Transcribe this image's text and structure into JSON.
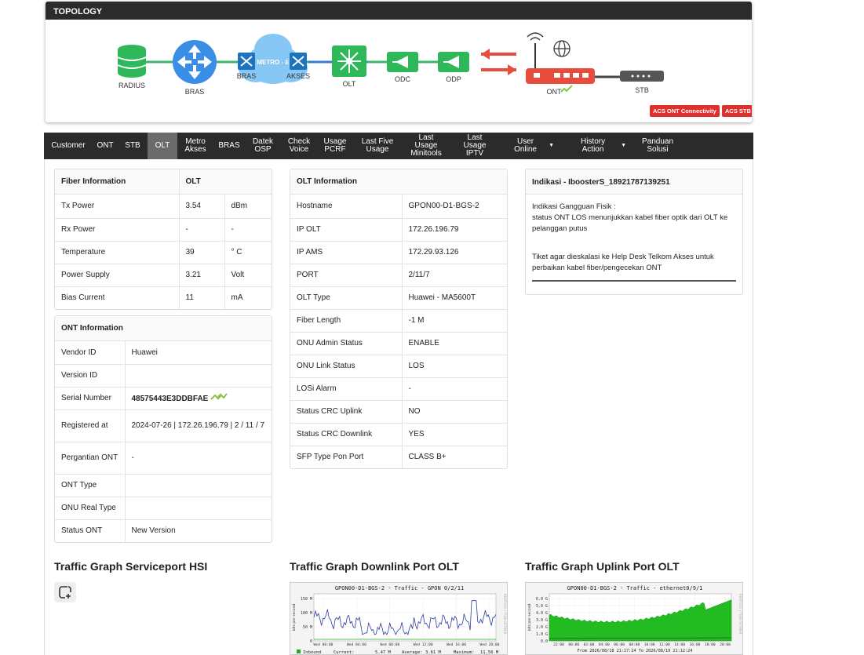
{
  "topology": {
    "title": "TOPOLOGY",
    "nodes": {
      "radius": "RADIUS",
      "bras": "BRAS",
      "bras2": "BRAS",
      "metro": "METRO - E",
      "akses": "AKSES",
      "olt": "OLT",
      "odc": "ODC",
      "odp": "ODP",
      "ont": "ONT",
      "stb": "STB"
    },
    "acs_ont": "ACS ONT Connectivity",
    "acs_stb": "ACS STB Connectivity"
  },
  "nav": [
    {
      "label": "Customer",
      "active": false
    },
    {
      "label": "ONT",
      "active": false
    },
    {
      "label": "STB",
      "active": false
    },
    {
      "label": "OLT",
      "active": true
    },
    {
      "label": "Metro\nAkses",
      "active": false
    },
    {
      "label": "BRAS",
      "active": false
    },
    {
      "label": "Datek\nOSP",
      "active": false
    },
    {
      "label": "Check\nVoice",
      "active": false
    },
    {
      "label": "Usage\nPCRF",
      "active": false
    },
    {
      "label": "Last Five\nUsage",
      "active": false
    },
    {
      "label": "Last Usage\nMinitools",
      "active": false
    },
    {
      "label": "Last Usage\nIPTV",
      "active": false
    },
    {
      "label": "User Online",
      "active": false,
      "dropdown": true
    },
    {
      "label": "History Action",
      "active": false,
      "dropdown": true
    },
    {
      "label": "Panduan\nSolusi",
      "active": false
    }
  ],
  "fiber": {
    "header": [
      "Fiber Information",
      "OLT"
    ],
    "rows": [
      [
        "Tx Power",
        "3.54",
        "dBm"
      ],
      [
        "Rx Power",
        "-",
        "-"
      ],
      [
        "Temperature",
        "39",
        "° C"
      ],
      [
        "Power Supply",
        "3.21",
        "Volt"
      ],
      [
        "Bias Current",
        "11",
        "mA"
      ]
    ]
  },
  "ont": {
    "title": "ONT Information",
    "rows": [
      [
        "Vendor ID",
        "Huawei"
      ],
      [
        "Version ID",
        ""
      ],
      [
        "Serial Number",
        "48575443E3DDBFAE"
      ],
      [
        "Registered at",
        "2024-07-26 | 172.26.196.79 | 2 / 11 / 7"
      ],
      [
        "Pergantian ONT",
        "-"
      ],
      [
        "ONT Type",
        ""
      ],
      [
        "ONU Real Type",
        ""
      ],
      [
        "Status ONT",
        "New Version"
      ]
    ]
  },
  "olt": {
    "title": "OLT Information",
    "rows": [
      [
        "Hostname",
        "GPON00-D1-BGS-2"
      ],
      [
        "IP OLT",
        "172.26.196.79"
      ],
      [
        "IP AMS",
        "172.29.93.126"
      ],
      [
        "PORT",
        "2/11/7"
      ],
      [
        "OLT Type",
        "Huawei - MA5600T"
      ],
      [
        "Fiber Length",
        "-1 M"
      ],
      [
        "ONU Admin Status",
        "ENABLE"
      ],
      [
        "ONU Link Status",
        "LOS"
      ],
      [
        "LOSi Alarm",
        "-"
      ],
      [
        "Status CRC Uplink",
        "NO"
      ],
      [
        "Status CRC Downlink",
        "YES"
      ],
      [
        "SFP Type Pon Port",
        "CLASS B+"
      ]
    ]
  },
  "indikasi": {
    "title": "Indikasi - IboosterS_18921787139251",
    "line1": "Indikasi Gangguan Fisik :",
    "line2": "status ONT LOS menunjukkan kabel fiber optik dari OLT ke pelanggan putus",
    "line3": "Tiket agar dieskalasi ke Help Desk Telkom Akses untuk perbaikan kabel fiber/pengecekan ONT"
  },
  "traffic": {
    "hsi_title": "Traffic Graph Serviceport HSI",
    "down_title": "Traffic Graph Downlink Port OLT",
    "up_title": "Traffic Graph Uplink Port OLT",
    "down_graph": {
      "title": "GPON00-D1-BGS-2 - Traffic - GPON 0/2/11",
      "yaxis": "bits per second",
      "yticks": [
        "150 M",
        "100 M",
        "50 M",
        "0"
      ],
      "xticks": [
        "Wed 00:00",
        "Wed 04:00",
        "Wed 08:00",
        "Wed 12:00",
        "Wed 16:00",
        "Wed 20:00"
      ],
      "legend": "Inbound",
      "current": "Current:",
      "current_val": "5.47 M",
      "average": "Average:",
      "average_val": "3.61 M",
      "maximum": "Maximum:",
      "maximum_val": "11.56 M",
      "side": "RRDTOOL / TOBI OETIKER",
      "color": "#2a3fa0"
    },
    "up_graph": {
      "title": "GPON00-D1-BGS-2 - Traffic - ethernet0/9/1",
      "yaxis": "bits per second",
      "yticks": [
        "6.0 G",
        "5.0 G",
        "4.0 G",
        "3.0 G",
        "2.0 G",
        "1.0 G",
        "0.0"
      ],
      "xticks": [
        "22:00",
        "00:00",
        "02:00",
        "04:00",
        "06:00",
        "08:00",
        "10:00",
        "12:00",
        "14:00",
        "16:00",
        "18:00",
        "20:00"
      ],
      "footer": "From 2026/08/18 21:17:24 To 2026/08/19 21:12:24",
      "side": "RRDTOOL / TOBI OETIKER",
      "color": "#22bb22"
    }
  }
}
